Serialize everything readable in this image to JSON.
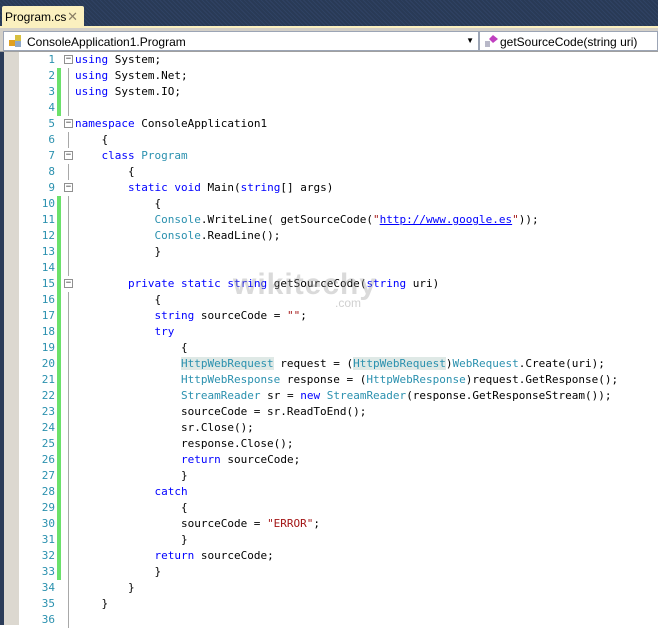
{
  "tab": {
    "title": "Program.cs",
    "close": "✕"
  },
  "nav": {
    "class_dropdown": "ConsoleApplication1.Program",
    "member_dropdown": "getSourceCode(string uri)"
  },
  "watermark": {
    "text": "wikitechy",
    "domain": ".com"
  },
  "colors": {
    "keyword": "#0000ff",
    "type": "#2b91af",
    "string": "#a31515",
    "changed": "#6be06b"
  },
  "lines": [
    {
      "n": "1",
      "fold": "minus",
      "chg": false,
      "t": [
        [
          "kw",
          "using"
        ],
        [
          "pl",
          " System;"
        ]
      ]
    },
    {
      "n": "2",
      "chg": true,
      "t": [
        [
          "kw",
          "using"
        ],
        [
          "pl",
          " System.Net;"
        ]
      ]
    },
    {
      "n": "3",
      "chg": true,
      "t": [
        [
          "kw",
          "using"
        ],
        [
          "pl",
          " System.IO;"
        ]
      ]
    },
    {
      "n": "4",
      "chg": true,
      "t": []
    },
    {
      "n": "5",
      "fold": "minus",
      "t": [
        [
          "kw",
          "namespace"
        ],
        [
          "pl",
          " ConsoleApplication1"
        ]
      ]
    },
    {
      "n": "6",
      "t": [
        [
          "pl",
          "    {"
        ]
      ]
    },
    {
      "n": "7",
      "fold": "minus",
      "t": [
        [
          "pl",
          "    "
        ],
        [
          "kw",
          "class"
        ],
        [
          "pl",
          " "
        ],
        [
          "ty",
          "Program"
        ]
      ]
    },
    {
      "n": "8",
      "t": [
        [
          "pl",
          "        {"
        ]
      ]
    },
    {
      "n": "9",
      "fold": "minus",
      "t": [
        [
          "pl",
          "        "
        ],
        [
          "kw",
          "static"
        ],
        [
          "pl",
          " "
        ],
        [
          "kw",
          "void"
        ],
        [
          "pl",
          " Main("
        ],
        [
          "kw",
          "string"
        ],
        [
          "pl",
          "[] args)"
        ]
      ]
    },
    {
      "n": "10",
      "chg": true,
      "t": [
        [
          "pl",
          "            {"
        ]
      ]
    },
    {
      "n": "11",
      "chg": true,
      "t": [
        [
          "pl",
          "            "
        ],
        [
          "ty",
          "Console"
        ],
        [
          "pl",
          ".WriteLine( getSourceCode("
        ],
        [
          "st",
          "\""
        ],
        [
          "lk",
          "http://www.google.es"
        ],
        [
          "st",
          "\""
        ],
        [
          "pl",
          "));"
        ]
      ]
    },
    {
      "n": "12",
      "chg": true,
      "t": [
        [
          "pl",
          "            "
        ],
        [
          "ty",
          "Console"
        ],
        [
          "pl",
          ".ReadLine();"
        ]
      ]
    },
    {
      "n": "13",
      "chg": true,
      "t": [
        [
          "pl",
          "            }"
        ]
      ]
    },
    {
      "n": "14",
      "chg": true,
      "t": []
    },
    {
      "n": "15",
      "chg": true,
      "fold": "minus",
      "t": [
        [
          "pl",
          "        "
        ],
        [
          "kw",
          "private"
        ],
        [
          "pl",
          " "
        ],
        [
          "kw",
          "static"
        ],
        [
          "pl",
          " "
        ],
        [
          "kw",
          "string"
        ],
        [
          "pl",
          " getSourceCode("
        ],
        [
          "kw",
          "string"
        ],
        [
          "pl",
          " uri)"
        ]
      ]
    },
    {
      "n": "16",
      "chg": true,
      "t": [
        [
          "pl",
          "            {"
        ]
      ]
    },
    {
      "n": "17",
      "chg": true,
      "t": [
        [
          "pl",
          "            "
        ],
        [
          "kw",
          "string"
        ],
        [
          "pl",
          " sourceCode = "
        ],
        [
          "st",
          "\"\""
        ],
        [
          "pl",
          ";"
        ]
      ]
    },
    {
      "n": "18",
      "chg": true,
      "t": [
        [
          "pl",
          "            "
        ],
        [
          "kw",
          "try"
        ]
      ]
    },
    {
      "n": "19",
      "chg": true,
      "t": [
        [
          "pl",
          "                {"
        ]
      ]
    },
    {
      "n": "20",
      "chg": true,
      "t": [
        [
          "pl",
          "                "
        ],
        [
          "hl",
          "HttpWebRequest"
        ],
        [
          "pl",
          " request = ("
        ],
        [
          "hl",
          "HttpWebRequest"
        ],
        [
          "pl",
          ")"
        ],
        [
          "ty",
          "WebRequest"
        ],
        [
          "pl",
          ".Create(uri);"
        ]
      ]
    },
    {
      "n": "21",
      "chg": true,
      "t": [
        [
          "pl",
          "                "
        ],
        [
          "ty",
          "HttpWebResponse"
        ],
        [
          "pl",
          " response = ("
        ],
        [
          "ty",
          "HttpWebResponse"
        ],
        [
          "pl",
          ")request.GetResponse();"
        ]
      ]
    },
    {
      "n": "22",
      "chg": true,
      "t": [
        [
          "pl",
          "                "
        ],
        [
          "ty",
          "StreamReader"
        ],
        [
          "pl",
          " sr = "
        ],
        [
          "kw",
          "new"
        ],
        [
          "pl",
          " "
        ],
        [
          "ty",
          "StreamReader"
        ],
        [
          "pl",
          "(response.GetResponseStream());"
        ]
      ]
    },
    {
      "n": "23",
      "chg": true,
      "t": [
        [
          "pl",
          "                sourceCode = sr.ReadToEnd();"
        ]
      ]
    },
    {
      "n": "24",
      "chg": true,
      "t": [
        [
          "pl",
          "                sr.Close();"
        ]
      ]
    },
    {
      "n": "25",
      "chg": true,
      "t": [
        [
          "pl",
          "                response.Close();"
        ]
      ]
    },
    {
      "n": "26",
      "chg": true,
      "t": [
        [
          "pl",
          "                "
        ],
        [
          "kw",
          "return"
        ],
        [
          "pl",
          " sourceCode;"
        ]
      ]
    },
    {
      "n": "27",
      "chg": true,
      "t": [
        [
          "pl",
          "                }"
        ]
      ]
    },
    {
      "n": "28",
      "chg": true,
      "t": [
        [
          "pl",
          "            "
        ],
        [
          "kw",
          "catch"
        ]
      ]
    },
    {
      "n": "29",
      "chg": true,
      "t": [
        [
          "pl",
          "                {"
        ]
      ]
    },
    {
      "n": "30",
      "chg": true,
      "t": [
        [
          "pl",
          "                sourceCode = "
        ],
        [
          "st",
          "\"ERROR\""
        ],
        [
          "pl",
          ";"
        ]
      ]
    },
    {
      "n": "31",
      "chg": true,
      "t": [
        [
          "pl",
          "                }"
        ]
      ]
    },
    {
      "n": "32",
      "chg": true,
      "t": [
        [
          "pl",
          "            "
        ],
        [
          "kw",
          "return"
        ],
        [
          "pl",
          " sourceCode;"
        ]
      ]
    },
    {
      "n": "33",
      "chg": true,
      "t": [
        [
          "pl",
          "            }"
        ]
      ]
    },
    {
      "n": "34",
      "t": [
        [
          "pl",
          "        }"
        ]
      ]
    },
    {
      "n": "35",
      "t": [
        [
          "pl",
          "    }"
        ]
      ]
    },
    {
      "n": "36",
      "t": []
    }
  ]
}
